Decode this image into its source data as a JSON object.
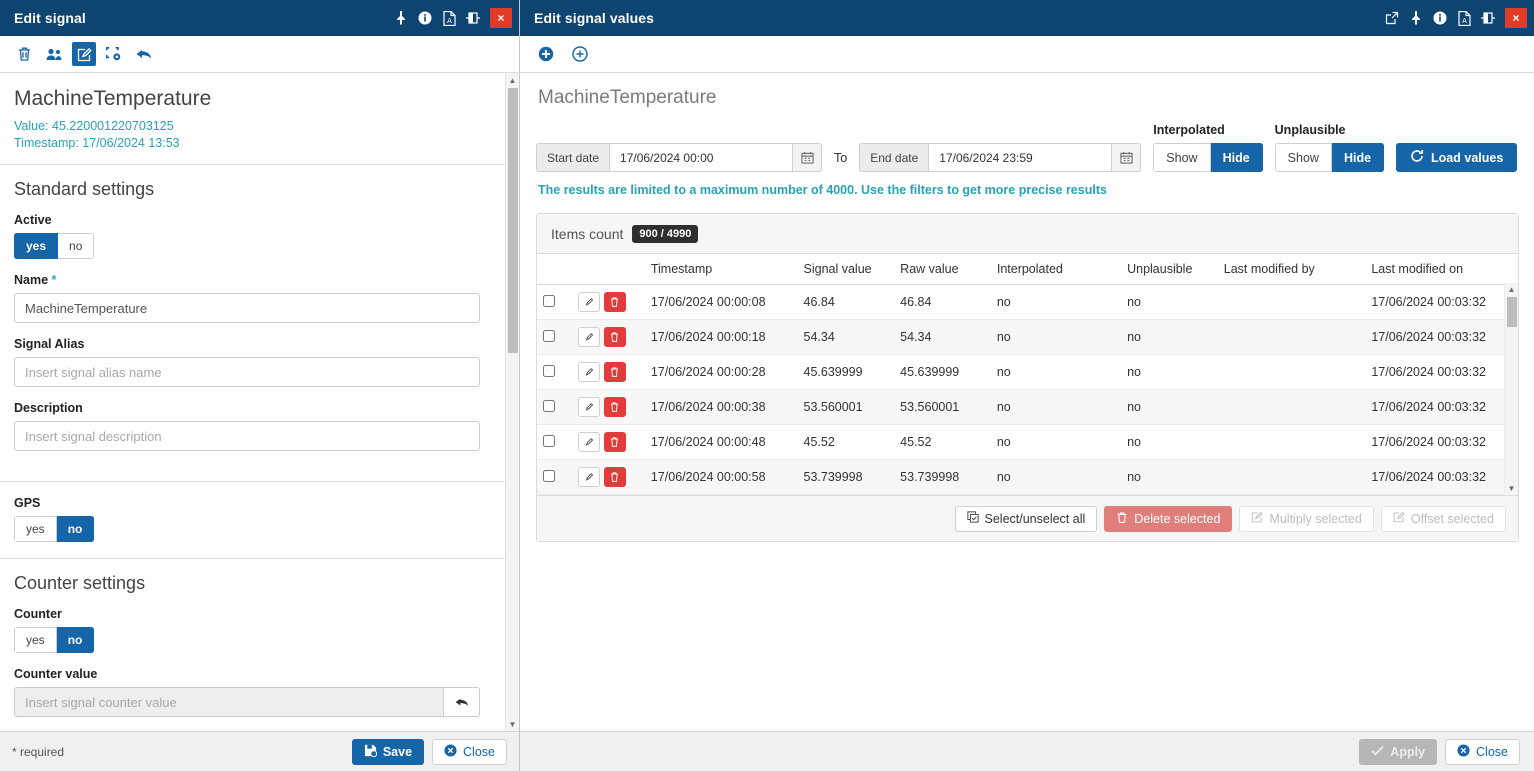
{
  "left": {
    "title": "Edit signal",
    "titlebar_icons": [
      "pin-icon",
      "info-icon",
      "pdf-icon",
      "split-view-icon"
    ],
    "close_label": "×",
    "toolbar": [
      {
        "name": "delete-icon",
        "label": "Delete"
      },
      {
        "name": "users-icon",
        "label": "Users"
      },
      {
        "name": "edit-icon",
        "label": "Edit"
      },
      {
        "name": "configure-icon",
        "label": "Configure"
      },
      {
        "name": "undo-icon",
        "label": "Undo"
      }
    ],
    "signal": {
      "name": "MachineTemperature",
      "value_line": "Value: 45.220001220703125",
      "timestamp_line": "Timestamp: 17/06/2024 13:53"
    },
    "standard_settings": {
      "heading": "Standard settings",
      "active_label": "Active",
      "active_yes": "yes",
      "active_no": "no",
      "active_selected": "yes",
      "name_label": "Name",
      "name_required_mark": "*",
      "name_value": "MachineTemperature",
      "alias_label": "Signal Alias",
      "alias_value": "",
      "alias_placeholder": "Insert signal alias name",
      "description_label": "Description",
      "description_value": "",
      "description_placeholder": "Insert signal description"
    },
    "gps": {
      "label": "GPS",
      "yes": "yes",
      "no": "no",
      "selected": "no"
    },
    "counter_settings": {
      "heading": "Counter settings",
      "counter_label": "Counter",
      "yes": "yes",
      "no": "no",
      "selected": "no",
      "counter_value_label": "Counter value",
      "counter_value": "",
      "counter_value_placeholder": "Insert signal counter value"
    },
    "footer": {
      "required_note": "* required",
      "save_label": "Save",
      "close_label": "Close"
    }
  },
  "right": {
    "title": "Edit signal values",
    "titlebar_icons": [
      "popout-icon",
      "pin-icon",
      "info-icon",
      "pdf-icon",
      "split-view-icon"
    ],
    "close_label": "×",
    "toolbar": [
      {
        "name": "add-value-icon",
        "label": "Add value"
      },
      {
        "name": "add-interval-icon",
        "label": "Add interval"
      }
    ],
    "page_title": "MachineTemperature",
    "filters": {
      "start_label": "Start date",
      "start_value": "17/06/2024 00:00",
      "to_label": "To",
      "end_label": "End date",
      "end_value": "17/06/2024 23:59",
      "interpolated_caption": "Interpolated",
      "interpolated_show": "Show",
      "interpolated_hide": "Hide",
      "interpolated_selected": "Hide",
      "unplausible_caption": "Unplausible",
      "unplausible_show": "Show",
      "unplausible_hide": "Hide",
      "unplausible_selected": "Hide",
      "load_label": "Load values"
    },
    "limit_note": "The results are limited to a maximum number of 4000. Use the filters to get more precise results",
    "table": {
      "items_count_label": "Items count",
      "items_count_value": "900 / 4990",
      "columns": [
        "",
        "",
        "Timestamp",
        "Signal value",
        "Raw value",
        "Interpolated",
        "Unplausible",
        "Last modified by",
        "Last modified on"
      ],
      "rows": [
        {
          "timestamp": "17/06/2024 00:00:08",
          "signal_value": "46.84",
          "raw_value": "46.84",
          "interpolated": "no",
          "unplausible": "no",
          "last_modified_by": "",
          "last_modified_on": "17/06/2024 00:03:32"
        },
        {
          "timestamp": "17/06/2024 00:00:18",
          "signal_value": "54.34",
          "raw_value": "54.34",
          "interpolated": "no",
          "unplausible": "no",
          "last_modified_by": "",
          "last_modified_on": "17/06/2024 00:03:32"
        },
        {
          "timestamp": "17/06/2024 00:00:28",
          "signal_value": "45.639999",
          "raw_value": "45.639999",
          "interpolated": "no",
          "unplausible": "no",
          "last_modified_by": "",
          "last_modified_on": "17/06/2024 00:03:32"
        },
        {
          "timestamp": "17/06/2024 00:00:38",
          "signal_value": "53.560001",
          "raw_value": "53.560001",
          "interpolated": "no",
          "unplausible": "no",
          "last_modified_by": "",
          "last_modified_on": "17/06/2024 00:03:32"
        },
        {
          "timestamp": "17/06/2024 00:00:48",
          "signal_value": "45.52",
          "raw_value": "45.52",
          "interpolated": "no",
          "unplausible": "no",
          "last_modified_by": "",
          "last_modified_on": "17/06/2024 00:03:32"
        },
        {
          "timestamp": "17/06/2024 00:00:58",
          "signal_value": "53.739998",
          "raw_value": "53.739998",
          "interpolated": "no",
          "unplausible": "no",
          "last_modified_by": "",
          "last_modified_on": "17/06/2024 00:03:32"
        }
      ],
      "actions": {
        "select_all": "Select/unselect all",
        "delete_selected": "Delete selected",
        "multiply_selected": "Multiply selected",
        "offset_selected": "Offset selected"
      }
    },
    "footer": {
      "apply_label": "Apply",
      "close_label": "Close"
    }
  },
  "colors": {
    "titlebar": "#0e4470",
    "accent": "#1565a8",
    "teal": "#27a3b5",
    "danger": "#e23b3b",
    "close": "#e03b24"
  }
}
